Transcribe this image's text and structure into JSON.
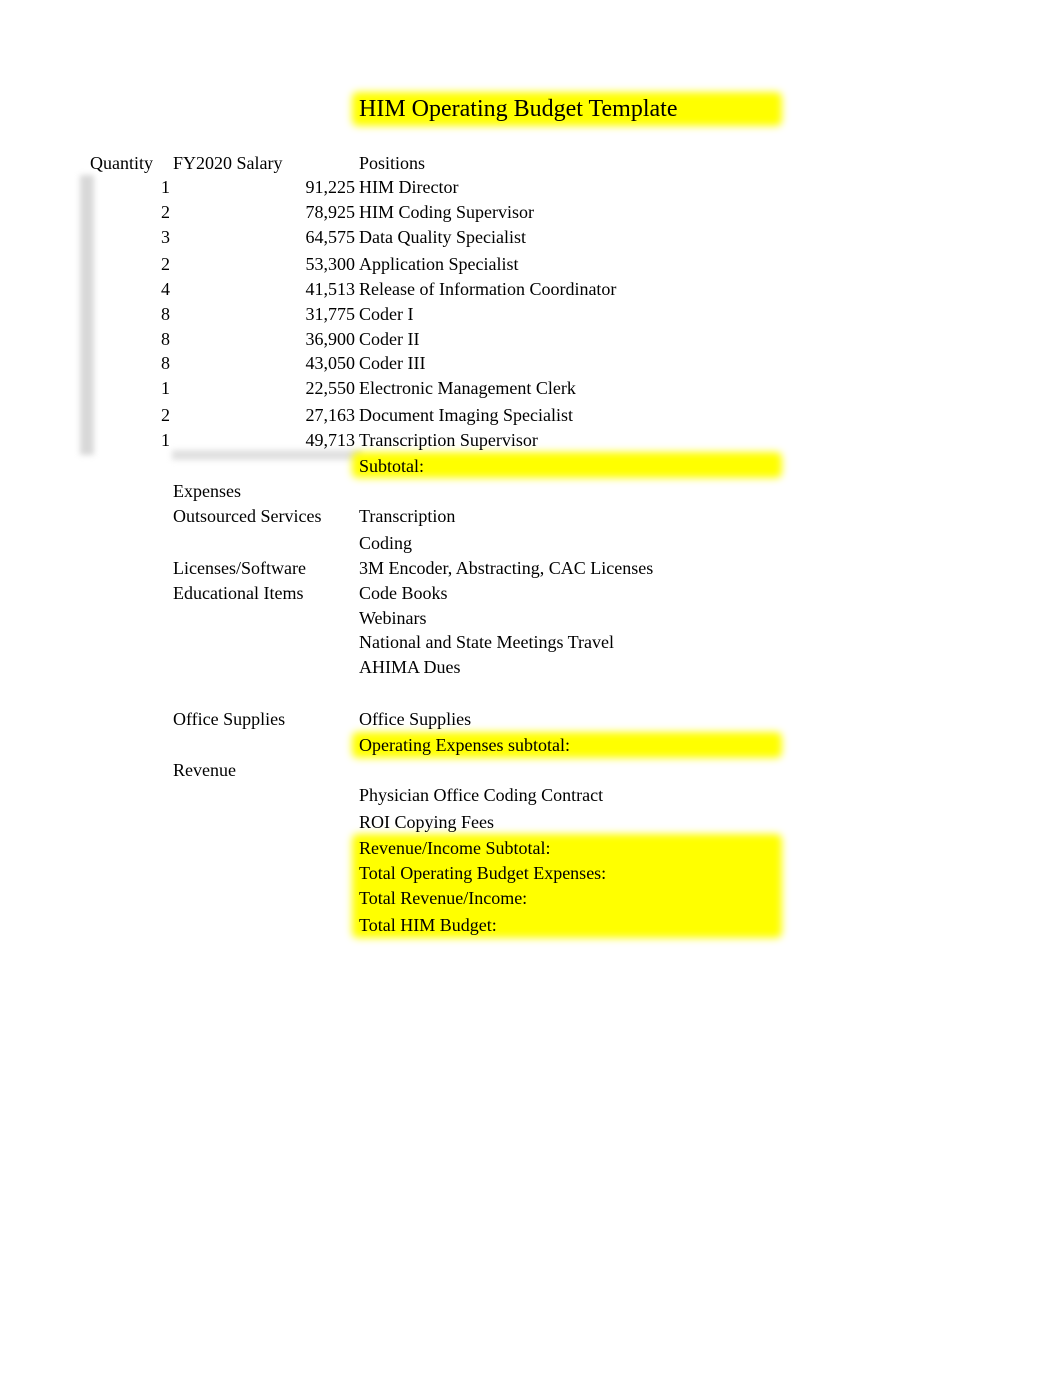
{
  "title": "HIM Operating Budget Template",
  "header": {
    "quantity": "Quantity",
    "salary": "FY2020 Salary",
    "positions": "Positions"
  },
  "positions": [
    {
      "quantity": "1",
      "salary": "91,225",
      "title": "HIM Director"
    },
    {
      "quantity": "2",
      "salary": "78,925",
      "title": "HIM Coding Supervisor"
    },
    {
      "quantity": "3",
      "salary": "64,575",
      "title": "Data Quality Specialist"
    },
    {
      "quantity": "2",
      "salary": "53,300",
      "title": "Application Specialist"
    },
    {
      "quantity": "4",
      "salary": "41,513",
      "title": "Release of Information Coordinator"
    },
    {
      "quantity": "8",
      "salary": "31,775",
      "title": "Coder I"
    },
    {
      "quantity": "8",
      "salary": "36,900",
      "title": "Coder II"
    },
    {
      "quantity": "8",
      "salary": "43,050",
      "title": "Coder III"
    },
    {
      "quantity": "1",
      "salary": "22,550",
      "title": "Electronic Management Clerk"
    },
    {
      "quantity": "2",
      "salary": "27,163",
      "title": "Document Imaging Specialist"
    },
    {
      "quantity": "1",
      "salary": "49,713",
      "title": "Transcription Supervisor"
    }
  ],
  "subtotal_label": "Subtotal:",
  "expenses": {
    "heading": "Expenses",
    "categories": [
      {
        "label": "Outsourced Services",
        "items": [
          "Transcription",
          "Coding"
        ]
      },
      {
        "label": "Licenses/Software",
        "items": [
          "3M Encoder, Abstracting, CAC Licenses"
        ]
      },
      {
        "label": "Educational Items",
        "items": [
          "Code Books",
          "Webinars",
          "National and State Meetings Travel",
          "AHIMA Dues"
        ]
      },
      {
        "label": "Office Supplies",
        "items": [
          "Office Supplies"
        ]
      }
    ],
    "subtotal_label": "Operating Expenses subtotal:"
  },
  "revenue": {
    "heading": "Revenue",
    "items": [
      "Physician Office Coding Contract",
      "ROI Copying Fees"
    ]
  },
  "totals": [
    "Revenue/Income Subtotal:",
    "Total Operating Budget Expenses:",
    "Total Revenue/Income:",
    "Total HIM Budget:"
  ],
  "colors": {
    "highlight": "#ffff00",
    "text": "#000000"
  }
}
